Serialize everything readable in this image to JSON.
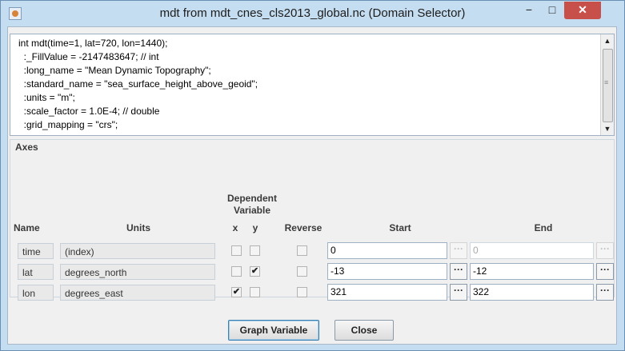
{
  "window": {
    "title": "mdt from mdt_cnes_cls2013_global.nc (Domain Selector)",
    "controls": {
      "minimize": "−",
      "maximize": "□",
      "close": "✕"
    }
  },
  "variable_info": {
    "lines": [
      "int mdt(time=1, lat=720, lon=1440);",
      "  :_FillValue = -2147483647; // int",
      "  :long_name = \"Mean Dynamic Topography\";",
      "  :standard_name = \"sea_surface_height_above_geoid\";",
      "  :units = \"m\";",
      "  :scale_factor = 1.0E-4; // double",
      "  :grid_mapping = \"crs\";"
    ]
  },
  "axes": {
    "title": "Axes",
    "headers": {
      "name": "Name",
      "units": "Units",
      "dependent_line1": "Dependent",
      "dependent_line2": "Variable",
      "x": "x",
      "y": "y",
      "reverse": "Reverse",
      "start": "Start",
      "end": "End"
    },
    "rows": [
      {
        "name": "time",
        "units": "(index)",
        "x": false,
        "y": false,
        "reverse": false,
        "start": "0",
        "end": "0",
        "enabled": false
      },
      {
        "name": "lat",
        "units": "degrees_north",
        "x": false,
        "y": true,
        "reverse": false,
        "start": "-13",
        "end": "-12",
        "enabled": true
      },
      {
        "name": "lon",
        "units": "degrees_east",
        "x": true,
        "y": false,
        "reverse": false,
        "start": "321",
        "end": "322",
        "enabled": true
      }
    ],
    "dots_label": "···"
  },
  "buttons": {
    "graph": "Graph Variable",
    "close": "Close"
  }
}
